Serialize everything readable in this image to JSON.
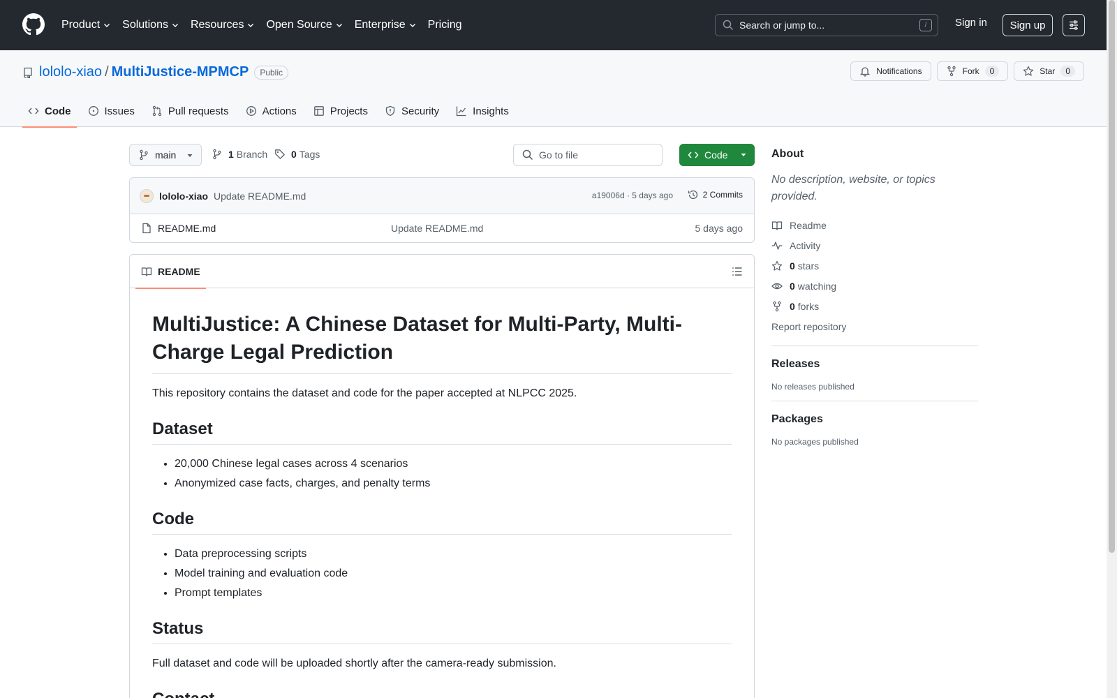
{
  "topnav": {
    "items": [
      "Product",
      "Solutions",
      "Resources",
      "Open Source",
      "Enterprise",
      "Pricing"
    ],
    "search_placeholder": "Search or jump to...",
    "search_key": "/",
    "signin": "Sign in",
    "signup": "Sign up"
  },
  "repo": {
    "owner": "lololo-xiao",
    "separator": "/",
    "name": "MultiJustice-MPMCP",
    "visibility": "Public",
    "notifications": "Notifications",
    "fork_label": "Fork",
    "fork_count": "0",
    "star_label": "Star",
    "star_count": "0"
  },
  "tabs": [
    "Code",
    "Issues",
    "Pull requests",
    "Actions",
    "Projects",
    "Security",
    "Insights"
  ],
  "filebar": {
    "branch": "main",
    "branch_count": "1",
    "branch_label": "Branch",
    "tag_count": "0",
    "tag_label": "Tags",
    "goto_placeholder": "Go to file",
    "code_button": "Code"
  },
  "commit": {
    "author": "lololo-xiao",
    "message": "Update README.md",
    "meta": "a19006d · 5 days ago",
    "commits": "2 Commits"
  },
  "files": [
    {
      "name": "README.md",
      "message": "Update README.md",
      "date": "5 days ago"
    }
  ],
  "readme": {
    "tab": "README",
    "title": "MultiJustice: A Chinese Dataset for Multi-Party, Multi-Charge Legal Prediction",
    "intro": "This repository contains the dataset and code for the paper accepted at NLPCC 2025.",
    "dataset_heading": "Dataset",
    "dataset_items": [
      "20,000 Chinese legal cases across 4 scenarios",
      "Anonymized case facts, charges, and penalty terms"
    ],
    "code_heading": "Code",
    "code_items": [
      "Data preprocessing scripts",
      "Model training and evaluation code",
      "Prompt templates"
    ],
    "status_heading": "Status",
    "status_text": "Full dataset and code will be uploaded shortly after the camera-ready submission.",
    "contact_heading": "Contact"
  },
  "about": {
    "title": "About",
    "description": "No description, website, or topics provided.",
    "readme": "Readme",
    "activity": "Activity",
    "stars_count": "0",
    "stars_label": "stars",
    "watching_count": "0",
    "watching_label": "watching",
    "forks_count": "0",
    "forks_label": "forks",
    "report": "Report repository"
  },
  "releases": {
    "title": "Releases",
    "empty": "No releases published"
  },
  "packages": {
    "title": "Packages",
    "empty": "No packages published"
  },
  "colors": {
    "header_bg": "#24292f",
    "link": "#0969da",
    "primary_button": "#1f883d",
    "tab_underline": "#fd8c73"
  }
}
